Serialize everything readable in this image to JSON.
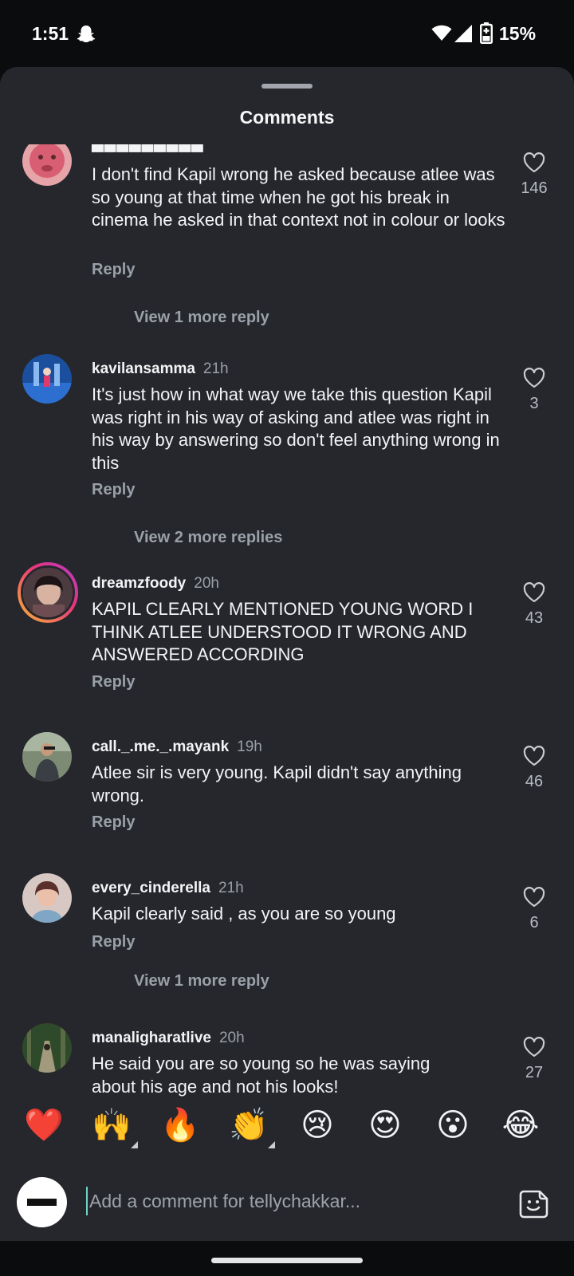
{
  "status": {
    "time": "1:51",
    "battery": "15%",
    "icons": [
      "snapchat-icon",
      "wifi-icon",
      "cellular-icon",
      "battery-icon"
    ]
  },
  "sheet": {
    "title": "Comments"
  },
  "comments": [
    {
      "username": "",
      "time": "",
      "text": "I don't find Kapil wrong he asked because atlee was so young at that time when he got his break in cinema he asked in that context not in colour or looks",
      "reply": "Reply",
      "likes": "146",
      "view_more": "View 1 more reply"
    },
    {
      "username": "kavilansamma",
      "time": "21h",
      "text": "It's just how in what way we take this question Kapil was right in his way of asking and atlee was right in his way by answering so don't feel anything wrong in this",
      "reply": "Reply",
      "likes": "3",
      "view_more": "View 2 more replies"
    },
    {
      "username": "dreamzfoody",
      "time": "20h",
      "text": "KAPIL CLEARLY MENTIONED YOUNG WORD I THINK ATLEE UNDERSTOOD IT WRONG AND ANSWERED ACCORDING",
      "reply": "Reply",
      "likes": "43"
    },
    {
      "username": "call._.me._.mayank",
      "time": "19h",
      "text": "Atlee sir is very young. Kapil didn't say anything wrong.",
      "reply": "Reply",
      "likes": "46"
    },
    {
      "username": "every_cinderella",
      "time": "21h",
      "text": "Kapil clearly said , as you are so young",
      "reply": "Reply",
      "likes": "6",
      "view_more": "View 1 more reply"
    },
    {
      "username": "manaligharatlive",
      "time": "20h",
      "text": "He said you are so young so he was saying about his age and not his looks!",
      "likes": "27"
    }
  ],
  "emoji_bar": [
    "❤️",
    "🙌",
    "🔥",
    "👏",
    "😢",
    "😍",
    "😮",
    "😂"
  ],
  "composer": {
    "placeholder": "Add a comment for tellychakkar..."
  },
  "colors": {
    "sheet_bg": "#25272c",
    "text": "#f3f4f6",
    "muted": "#9aa0a8",
    "status_bg": "#0b0c0e"
  }
}
